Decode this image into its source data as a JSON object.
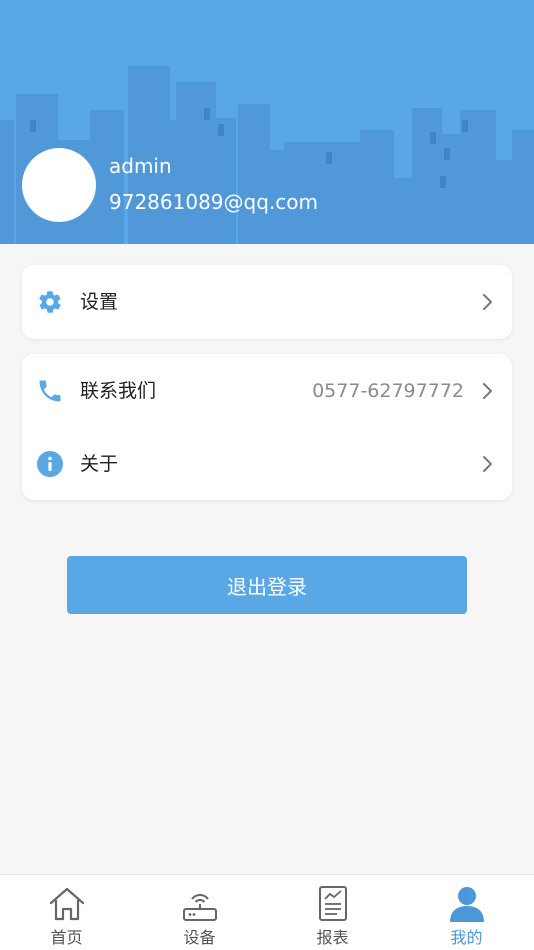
{
  "profile": {
    "username": "admin",
    "email": "972861089@qq.com"
  },
  "menu": {
    "settings_label": "设置",
    "contact_label": "联系我们",
    "contact_phone": "0577-62797772",
    "about_label": "关于"
  },
  "logout_label": "退出登录",
  "tabs": [
    {
      "label": "首页",
      "icon": "home-icon",
      "active": false
    },
    {
      "label": "设备",
      "icon": "router-icon",
      "active": false
    },
    {
      "label": "报表",
      "icon": "report-icon",
      "active": false
    },
    {
      "label": "我的",
      "icon": "person-icon",
      "active": true
    }
  ],
  "colors": {
    "accent": "#5aa7e5",
    "accent_dark": "#4a97da",
    "background": "#f6f6f6"
  }
}
